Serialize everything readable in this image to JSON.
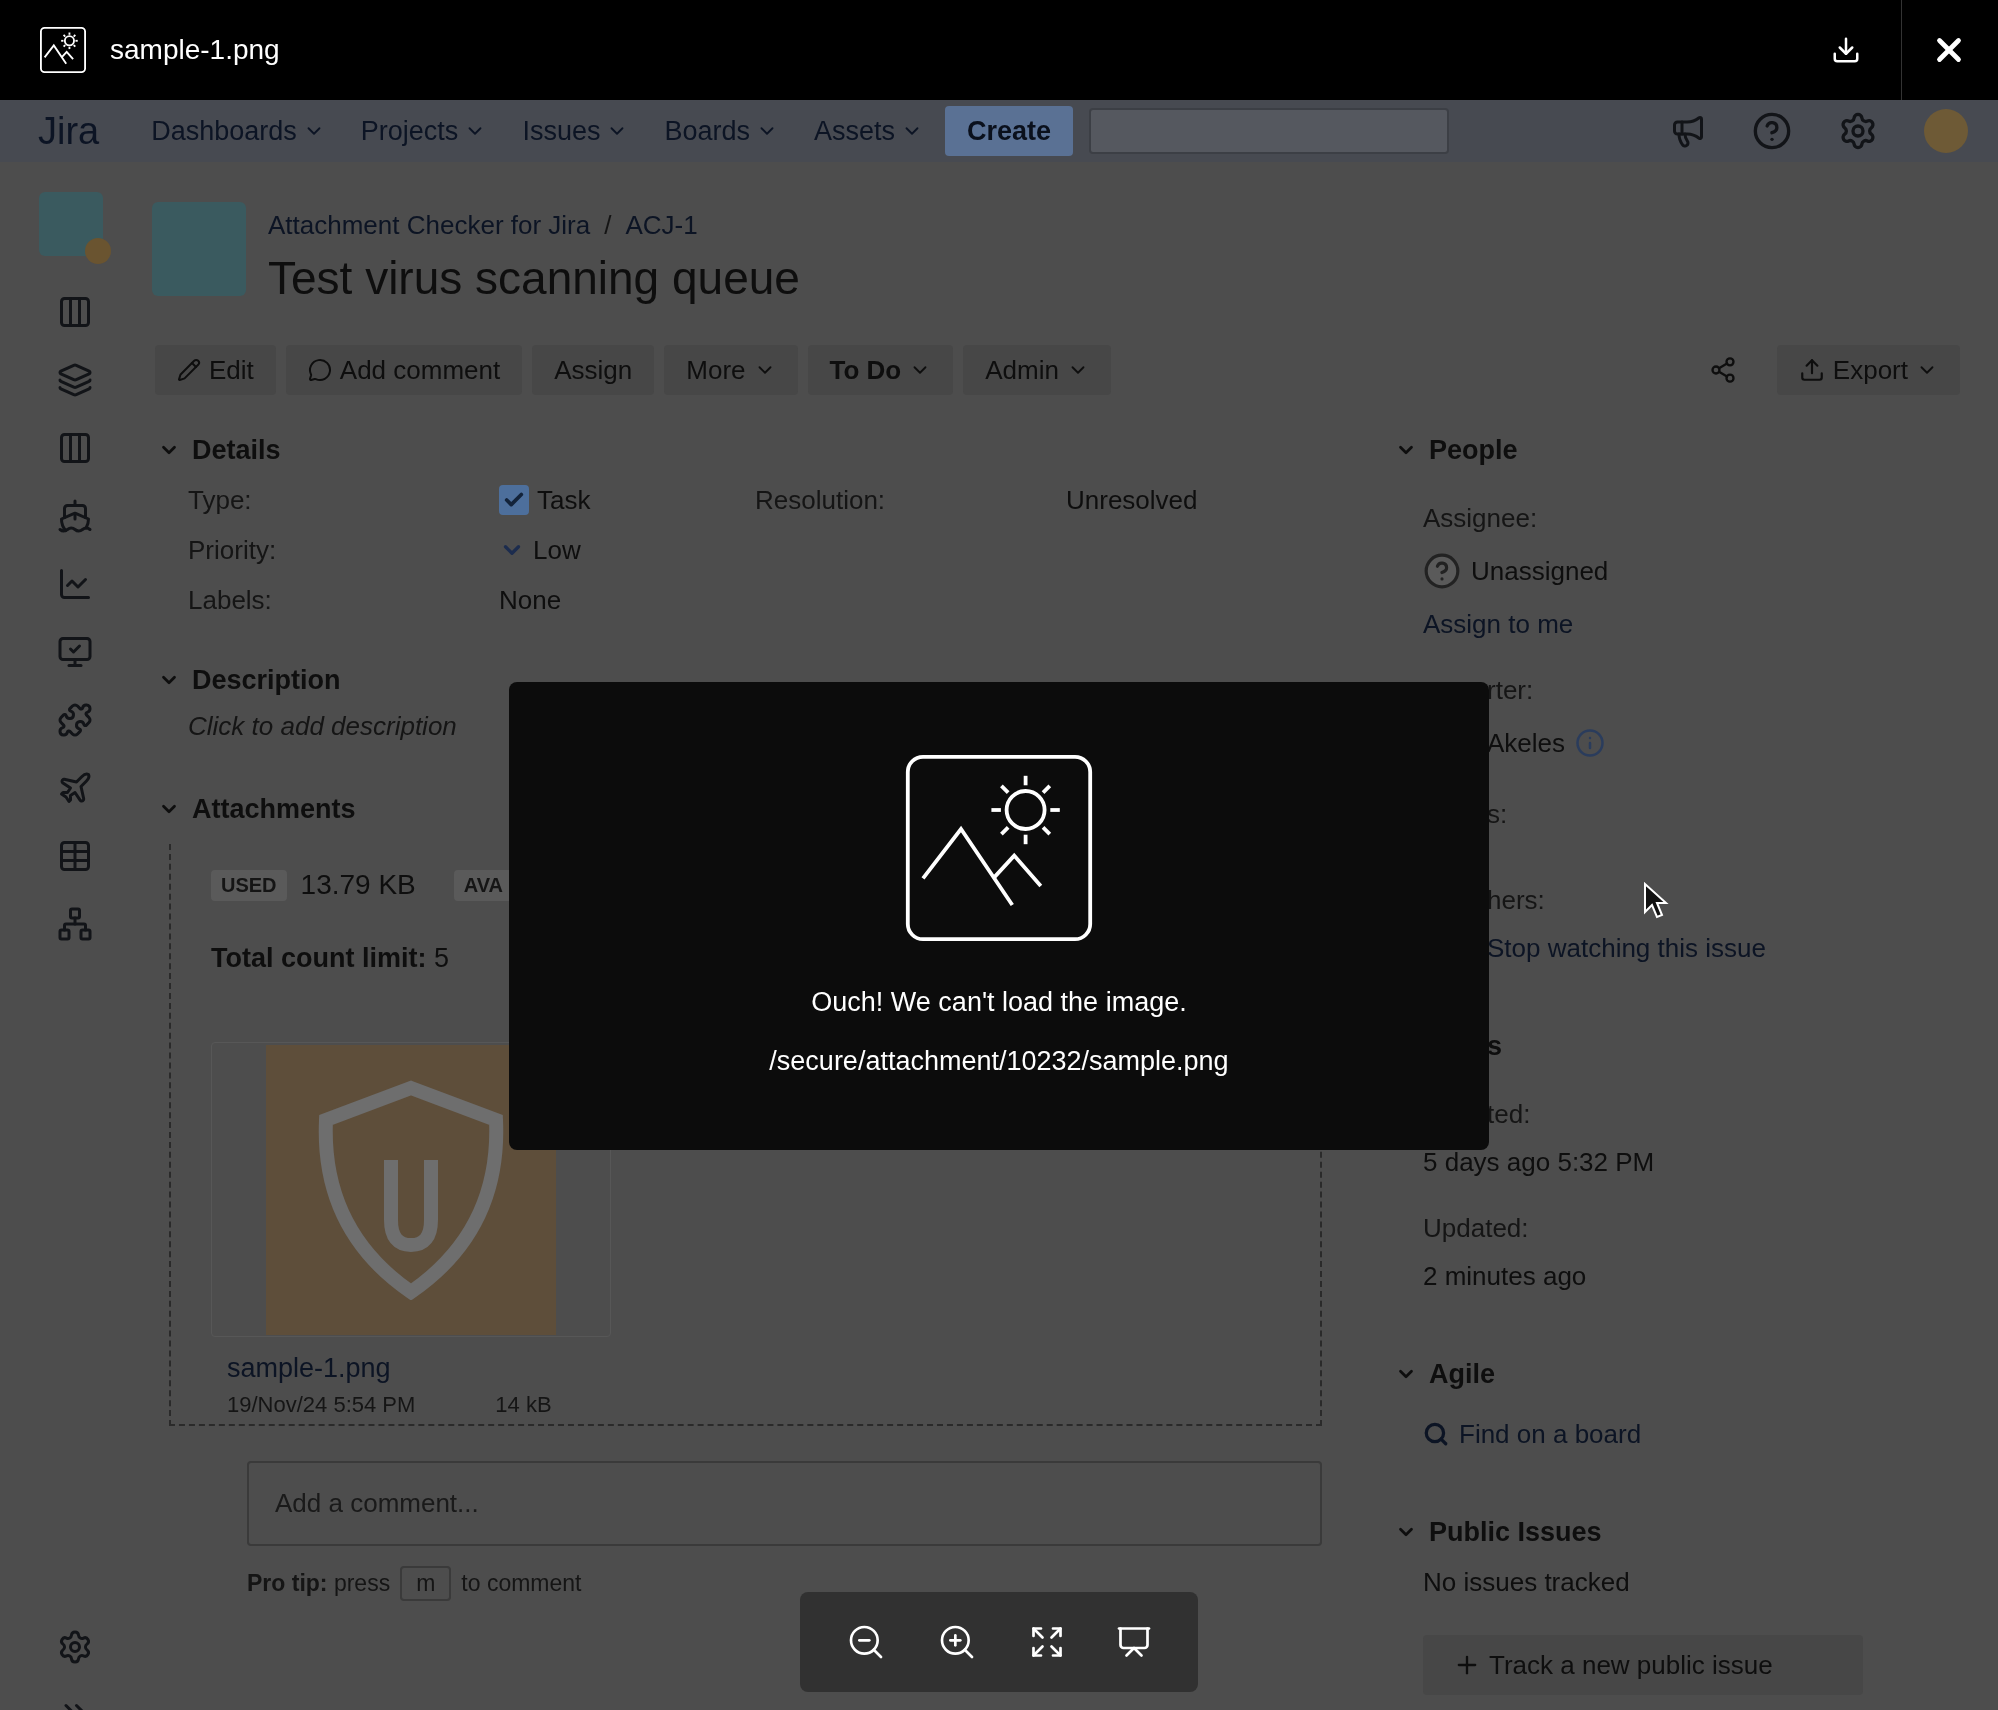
{
  "viewer": {
    "file_name": "sample-1.png",
    "error_message": "Ouch! We can't load the image.",
    "path": "/secure/attachment/10232/sample.png"
  },
  "nav": {
    "logo": "Jira",
    "items": [
      {
        "label": "Dashboards"
      },
      {
        "label": "Projects"
      },
      {
        "label": "Issues"
      },
      {
        "label": "Boards"
      },
      {
        "label": "Assets"
      }
    ],
    "create": "Create"
  },
  "breadcrumbs": [
    "Attachment Checker for Jira",
    "ACJ-1"
  ],
  "breadcrumb_separator": "/",
  "title": "Test virus scanning queue",
  "toolbar": [
    {
      "label": "Edit",
      "kind": "edit"
    },
    {
      "label": "Add comment",
      "kind": "comment"
    },
    {
      "label": "Assign",
      "kind": "plain"
    },
    {
      "label": "More",
      "kind": "dropdown"
    },
    {
      "label": "To Do",
      "kind": "status"
    },
    {
      "label": "Admin",
      "kind": "dropdown"
    }
  ],
  "export": "Export",
  "details": {
    "title": "Details",
    "rows": [
      [
        {
          "label": "Type:",
          "value": "Task",
          "kind": "type"
        },
        {
          "label": "Resolution:",
          "value": "Unresolved",
          "kind": "text"
        }
      ],
      [
        {
          "label": "Priority:",
          "value": "Low",
          "kind": "priority"
        }
      ],
      [
        {
          "label": "Labels:",
          "value": "None",
          "kind": "text"
        }
      ]
    ]
  },
  "description": {
    "title": "Description",
    "placeholder": "Click to add description"
  },
  "attachments": {
    "title": "Attachments",
    "used_label": "USED",
    "used_value": "13.79 KB",
    "available_label": "AVA",
    "count_limit": "**Total count limit:** 5",
    "files": [
      {
        "name": "sample-1.png",
        "date": "19/Nov/24 5:54 PM",
        "size": "14 kB"
      }
    ]
  },
  "comment": {
    "placeholder": "Add a comment...",
    "tip_before": "**Pro tip:** press",
    "key": "m",
    "tip_after": "to comment"
  },
  "sidebar_right": [
    {
      "title": "People",
      "items": [
        {
          "kind": "label",
          "text": "Assignee:"
        },
        {
          "kind": "user",
          "text": "Unassigned"
        },
        {
          "kind": "link",
          "text": "Assign to me"
        },
        {
          "kind": "label",
          "text": "rter:",
          "partial": true
        },
        {
          "kind": "reporter",
          "text": "Akeles",
          "partial": true
        },
        {
          "kind": "label",
          "text": "s:",
          "partial": true
        },
        {
          "kind": "label",
          "text": "hers:",
          "partial": true
        },
        {
          "kind": "link",
          "text": "Stop watching this issue",
          "partial": true
        }
      ]
    },
    {
      "title": "s",
      "title_partial": true,
      "items": [
        {
          "kind": "label",
          "text": "ted:",
          "partial": true
        },
        {
          "kind": "text",
          "text": "5 days ago 5:32 PM"
        },
        {
          "kind": "label",
          "text": "Updated:"
        },
        {
          "kind": "text",
          "text": "2 minutes ago"
        }
      ]
    },
    {
      "title": "Agile",
      "items": [
        {
          "kind": "search",
          "text": "Find on a board"
        }
      ]
    },
    {
      "title": "Public Issues",
      "items": [
        {
          "kind": "text",
          "text": "No issues tracked"
        },
        {
          "kind": "button",
          "text": "Track a new public issue"
        }
      ]
    }
  ]
}
